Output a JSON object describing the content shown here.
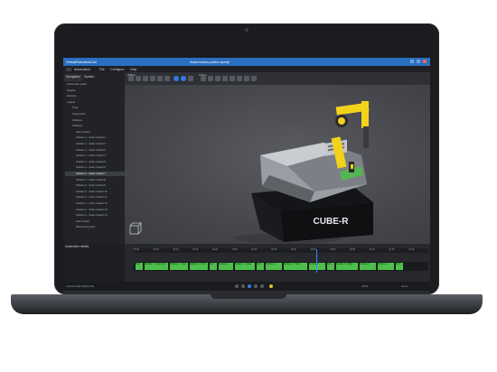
{
  "app": {
    "title": "VirtualRoboticsCell",
    "document_title": "Automotive-polish.vrproj*"
  },
  "menu": {
    "items": [
      "Automation",
      "File",
      "Configure",
      "Help"
    ]
  },
  "toolbar": {
    "group1_label": "Offline",
    "group2_label": "Online"
  },
  "left_panel": {
    "tabs": [
      "Navigation",
      "System"
    ],
    "tree": [
      {
        "label": "Automotive-polish",
        "selected": false
      },
      {
        "label": "Objects",
        "selected": false
      },
      {
        "label": "Gantries",
        "selected": false
      },
      {
        "label": "Logical",
        "selected": false
      },
      {
        "label": "Tools",
        "selected": false
      },
      {
        "label": "Trajectories",
        "selected": false
      },
      {
        "label": "Surface1",
        "selected": false
      },
      {
        "label": "Surface2",
        "selected": false
      },
      {
        "label": "Start contact",
        "selected": false
      },
      {
        "label": "Surface 1 - Scan contact 1",
        "selected": false
      },
      {
        "label": "Surface 1 - Scan contact 2",
        "selected": false
      },
      {
        "label": "Surface 1 - Scan contact 3",
        "selected": false
      },
      {
        "label": "Surface 1 - Scan contact 4",
        "selected": false
      },
      {
        "label": "Surface 1 - Scan contact 5",
        "selected": false
      },
      {
        "label": "Surface 1 - Scan contact 6",
        "selected": false
      },
      {
        "label": "Surface 2 - Scan contact 7",
        "selected": true
      },
      {
        "label": "Surface 2 - Scan contact 8",
        "selected": false
      },
      {
        "label": "Surface 2 - Scan contact 9",
        "selected": false
      },
      {
        "label": "Surface 2 - Scan contact 10",
        "selected": false
      },
      {
        "label": "Surface 2 - Scan contact 11",
        "selected": false
      },
      {
        "label": "Surface 2 - Scan contact 12",
        "selected": false
      },
      {
        "label": "Surface 2 - Scan contact 13",
        "selected": false
      },
      {
        "label": "Surface 2 - Scan contact 14",
        "selected": false
      },
      {
        "label": "End contact",
        "selected": false
      },
      {
        "label": "Reference points",
        "selected": false
      }
    ],
    "properties_title": "Automation details"
  },
  "viewport": {
    "platform_label": "CUBE-R"
  },
  "timeline": {
    "ticks": [
      "00:00",
      "00:05",
      "00:10",
      "00:15",
      "00:20",
      "00:25",
      "00:30",
      "00:35",
      "00:40",
      "00:45",
      "00:50",
      "00:55",
      "01:00",
      "01:05",
      "01:10"
    ],
    "segments": [
      "Surf",
      "Surface 1 - Scan cont",
      "Surface 1 - Scan",
      "Surface 1 - Scan",
      "Surf",
      "Surface 1",
      "Surface 1 - Scan",
      "Surf",
      "Surface 2",
      "Surface 2 - Scan",
      "Surface 2",
      "Surf",
      "Surface 2 - Scan",
      "Surface 2",
      "Surface 2",
      "Surf"
    ]
  },
  "status": {
    "left": "CALCULATE SIMULATE",
    "mid_left": "0:00",
    "zoom": "100%",
    "right": "Zoom"
  },
  "colors": {
    "accent": "#2f7de0",
    "segment_green": "#4cc04a",
    "robot_yellow": "#f3d21c"
  }
}
